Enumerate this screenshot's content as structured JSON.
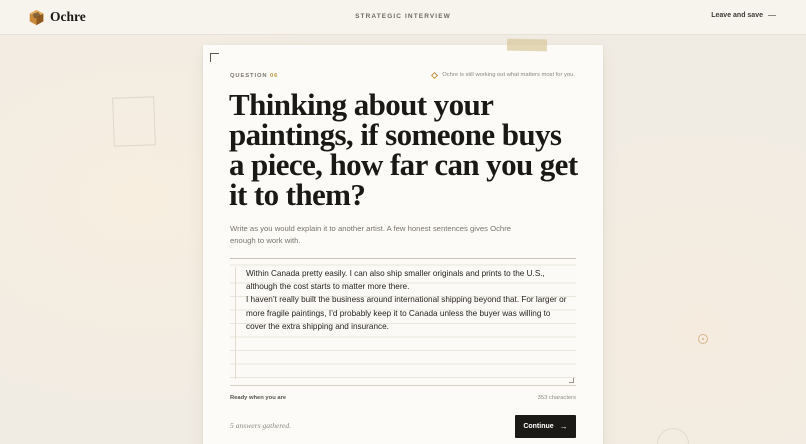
{
  "app": {
    "brand_name": "Ochre",
    "header_title": "STRATEGIC INTERVIEW",
    "leave_label": "Leave and save"
  },
  "question": {
    "label": "QUESTION",
    "number": "06",
    "status": "Ochre is still working out what matters most for you.",
    "text": "Thinking about your paintings, if someone buys a piece, how far can you get it to them?",
    "helper": "Write as you would explain it to another artist. A few honest sentences gives Ochre enough to work with."
  },
  "answer": {
    "paragraphs": [
      "Within Canada pretty easily. I can also ship smaller originals and prints to the U.S., although the cost starts to matter more there.",
      "I haven’t really built the business around international shipping beyond that. For larger or more fragile paintings, I’d probably keep it to Canada unless the buyer was willing to cover the extra shipping and insurance."
    ]
  },
  "footer": {
    "ready_label": "Ready when you are",
    "char_count": "353 characters",
    "gathered_label": "5 answers gathered.",
    "continue_label": "Continue"
  },
  "icons": {
    "brand": "ochre-logo-icon",
    "status": "diamond-icon",
    "continue": "arrow-right-icon"
  },
  "colors": {
    "accent": "#c9973f",
    "button_bg": "#1c1a17",
    "page_bg": "#f1ece3",
    "card_bg": "#fcfbf8"
  }
}
